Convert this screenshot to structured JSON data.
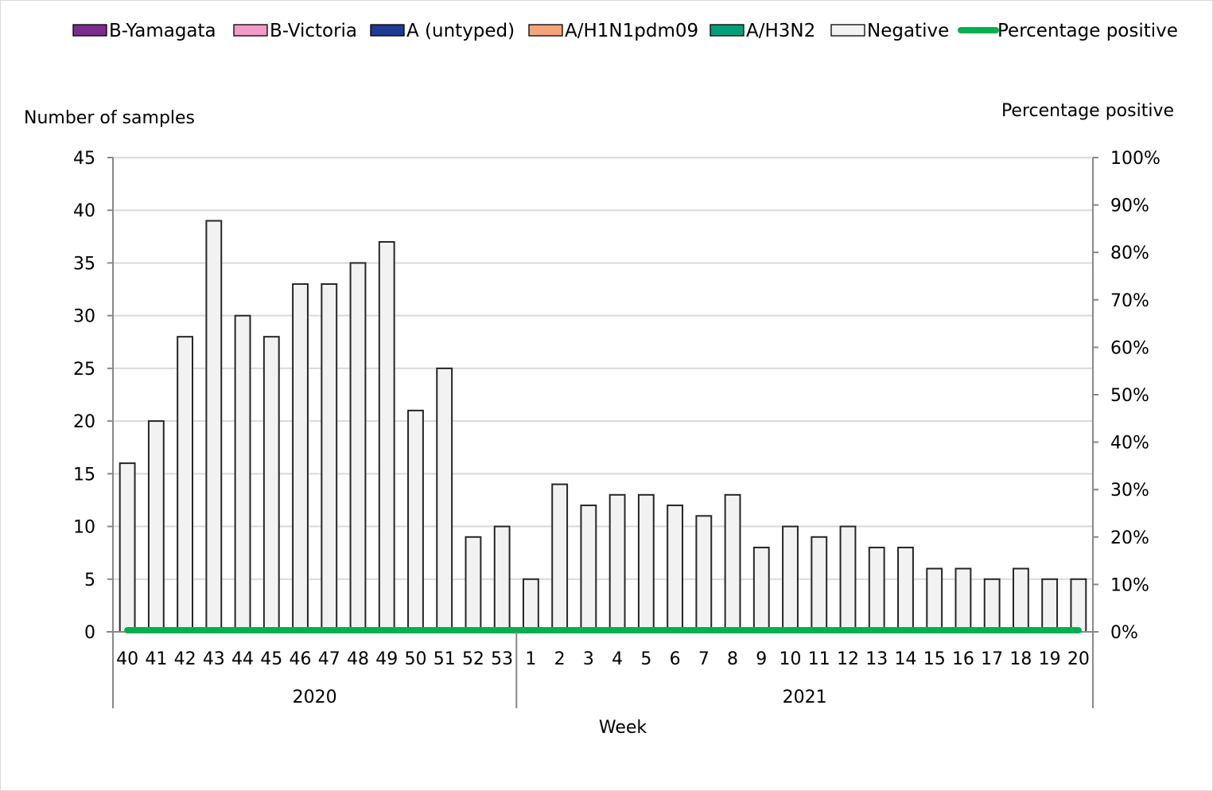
{
  "chart_data": {
    "type": "bar",
    "title": "",
    "xlabel": "Week",
    "ylabel": "Number of samples",
    "y2label": "Percentage positive",
    "ylim": [
      0,
      45
    ],
    "y_ticks": [
      "0",
      "5",
      "10",
      "15",
      "20",
      "25",
      "30",
      "35",
      "40",
      "45"
    ],
    "y_tick_values": [
      0,
      5,
      10,
      15,
      20,
      25,
      30,
      35,
      40,
      45
    ],
    "y2lim": [
      0,
      100
    ],
    "y2_ticks": [
      "0%",
      "10%",
      "20%",
      "30%",
      "40%",
      "50%",
      "60%",
      "70%",
      "80%",
      "90%",
      "100%"
    ],
    "y2_tick_values": [
      0,
      10,
      20,
      30,
      40,
      50,
      60,
      70,
      80,
      90,
      100
    ],
    "grid": true,
    "legend_position": "top",
    "categories": [
      "40",
      "41",
      "42",
      "43",
      "44",
      "45",
      "46",
      "47",
      "48",
      "49",
      "50",
      "51",
      "52",
      "53",
      "1",
      "2",
      "3",
      "4",
      "5",
      "6",
      "7",
      "8",
      "9",
      "10",
      "11",
      "12",
      "13",
      "14",
      "15",
      "16",
      "17",
      "18",
      "19",
      "20"
    ],
    "groups": [
      {
        "label": "2020",
        "count": 14
      },
      {
        "label": "2021",
        "count": 20
      }
    ],
    "series": [
      {
        "name": "B-Yamagata",
        "kind": "bar",
        "color": "#7B2D8E",
        "values": [
          0,
          0,
          0,
          0,
          0,
          0,
          0,
          0,
          0,
          0,
          0,
          0,
          0,
          0,
          0,
          0,
          0,
          0,
          0,
          0,
          0,
          0,
          0,
          0,
          0,
          0,
          0,
          0,
          0,
          0,
          0,
          0,
          0,
          0
        ]
      },
      {
        "name": "B-Victoria",
        "kind": "bar",
        "color": "#F19BC7",
        "values": [
          0,
          0,
          0,
          0,
          0,
          0,
          0,
          0,
          0,
          0,
          0,
          0,
          0,
          0,
          0,
          0,
          0,
          0,
          0,
          0,
          0,
          0,
          0,
          0,
          0,
          0,
          0,
          0,
          0,
          0,
          0,
          0,
          0,
          0
        ]
      },
      {
        "name": "A (untyped)",
        "kind": "bar",
        "color": "#1F3A93",
        "values": [
          0,
          0,
          0,
          0,
          0,
          0,
          0,
          0,
          0,
          0,
          0,
          0,
          0,
          0,
          0,
          0,
          0,
          0,
          0,
          0,
          0,
          0,
          0,
          0,
          0,
          0,
          0,
          0,
          0,
          0,
          0,
          0,
          0,
          0
        ]
      },
      {
        "name": "A/H1N1pdm09",
        "kind": "bar",
        "color": "#F4A47A",
        "values": [
          0,
          0,
          0,
          0,
          0,
          0,
          0,
          0,
          0,
          0,
          0,
          0,
          0,
          0,
          0,
          0,
          0,
          0,
          0,
          0,
          0,
          0,
          0,
          0,
          0,
          0,
          0,
          0,
          0,
          0,
          0,
          0,
          0,
          0
        ]
      },
      {
        "name": "A/H3N2",
        "kind": "bar",
        "color": "#00A07A",
        "values": [
          0,
          0,
          0,
          0,
          0,
          0,
          0,
          0,
          0,
          0,
          0,
          0,
          0,
          0,
          0,
          0,
          0,
          0,
          0,
          0,
          0,
          0,
          0,
          0,
          0,
          0,
          0,
          0,
          0,
          0,
          0,
          0,
          0,
          0
        ]
      },
      {
        "name": "Negative",
        "kind": "bar",
        "color": "#F2F2F2",
        "values": [
          16,
          20,
          28,
          39,
          30,
          28,
          33,
          33,
          35,
          37,
          21,
          25,
          9,
          10,
          5,
          14,
          12,
          13,
          13,
          12,
          11,
          13,
          8,
          10,
          9,
          10,
          8,
          8,
          6,
          6,
          5,
          6,
          5,
          5
        ]
      },
      {
        "name": "Percentage positive",
        "kind": "line",
        "axis": "right",
        "color": "#00B050",
        "values": [
          0,
          0,
          0,
          0,
          0,
          0,
          0,
          0,
          0,
          0,
          0,
          0,
          0,
          0,
          0,
          0,
          0,
          0,
          0,
          0,
          0,
          0,
          0,
          0,
          0,
          0,
          0,
          0,
          0,
          0,
          0,
          0,
          0,
          0
        ]
      }
    ]
  }
}
